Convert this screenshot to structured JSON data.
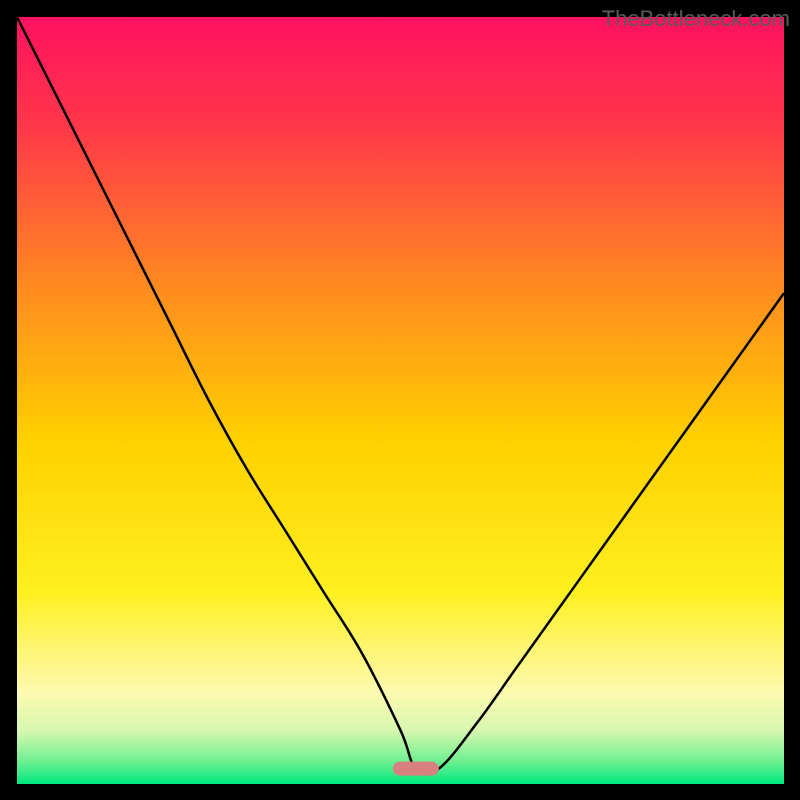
{
  "watermark": "TheBottleneck.com",
  "chart_data": {
    "type": "line",
    "title": "",
    "xlabel": "",
    "ylabel": "",
    "xlim": [
      0,
      100
    ],
    "ylim": [
      0,
      100
    ],
    "curve": {
      "description": "V-shaped bottleneck curve with minimum around x=52",
      "x": [
        0,
        5,
        10,
        15,
        20,
        25,
        30,
        35,
        40,
        45,
        50,
        52,
        55,
        60,
        65,
        70,
        75,
        80,
        85,
        90,
        95,
        100
      ],
      "y": [
        100,
        90,
        80,
        70,
        60,
        50,
        41,
        33,
        25,
        17,
        7,
        2,
        2,
        8,
        15,
        22,
        29,
        36,
        43,
        50,
        57,
        64
      ]
    },
    "marker": {
      "x": 52,
      "y": 2,
      "color": "#d88080",
      "shape": "rounded-bar"
    },
    "background_gradient": {
      "type": "vertical",
      "stops": [
        {
          "pos": 0.0,
          "color": "#ff1060"
        },
        {
          "pos": 0.15,
          "color": "#ff3a48"
        },
        {
          "pos": 0.35,
          "color": "#ff8a20"
        },
        {
          "pos": 0.55,
          "color": "#ffd000"
        },
        {
          "pos": 0.75,
          "color": "#fff020"
        },
        {
          "pos": 0.88,
          "color": "#fdfab0"
        },
        {
          "pos": 0.93,
          "color": "#d8f8b0"
        },
        {
          "pos": 0.97,
          "color": "#70f090"
        },
        {
          "pos": 1.0,
          "color": "#00e880"
        }
      ]
    }
  }
}
